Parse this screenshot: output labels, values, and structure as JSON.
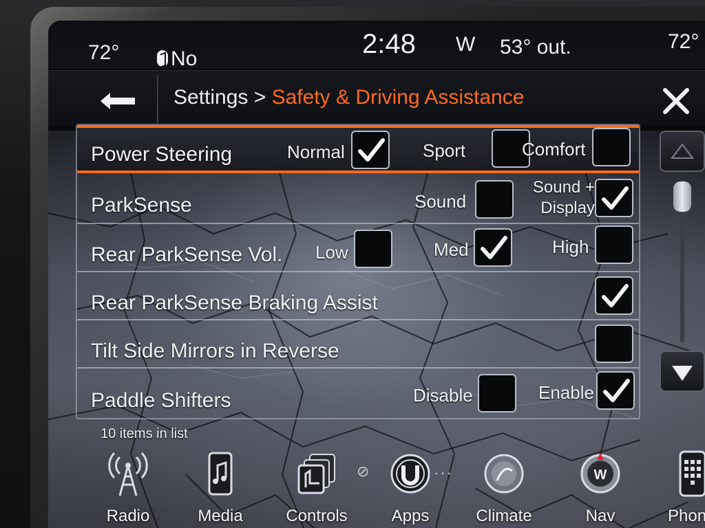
{
  "status": {
    "temp_left": "72°",
    "bluetooth_label": "No Device",
    "time": "2:48",
    "direction": "W",
    "outside_temp": "53° out.",
    "temp_right": "72°"
  },
  "header": {
    "breadcrumb_root": "Settings > ",
    "breadcrumb_current": "Safety & Driving Assistance"
  },
  "colors": {
    "accent": "#ff6a1f"
  },
  "settings": [
    {
      "label": "Power Steering",
      "selected": true,
      "options": [
        {
          "label": "Normal",
          "checked": true
        },
        {
          "label": "Sport",
          "checked": false
        },
        {
          "label": "Comfort",
          "checked": false
        }
      ]
    },
    {
      "label": "ParkSense",
      "options": [
        {
          "label": "Sound",
          "checked": false
        },
        {
          "label_line1": "Sound +",
          "label_line2": "Display",
          "checked": true
        }
      ]
    },
    {
      "label": "Rear ParkSense Vol.",
      "options": [
        {
          "label": "Low",
          "checked": false
        },
        {
          "label": "Med",
          "checked": true
        },
        {
          "label": "High",
          "checked": false
        }
      ]
    },
    {
      "label": "Rear ParkSense Braking Assist",
      "options": [
        {
          "checked": true
        }
      ]
    },
    {
      "label": "Tilt Side Mirrors in Reverse",
      "options": [
        {
          "checked": false
        }
      ]
    },
    {
      "label": "Paddle Shifters",
      "options": [
        {
          "label": "Disable",
          "checked": false
        },
        {
          "label": "Enable",
          "checked": true
        }
      ]
    }
  ],
  "list_footer": "10 items in list",
  "nav": {
    "radio": "Radio",
    "media": "Media",
    "controls": "Controls",
    "apps": "Apps",
    "climate": "Climate",
    "nav": "Nav",
    "phone": "Phon"
  }
}
